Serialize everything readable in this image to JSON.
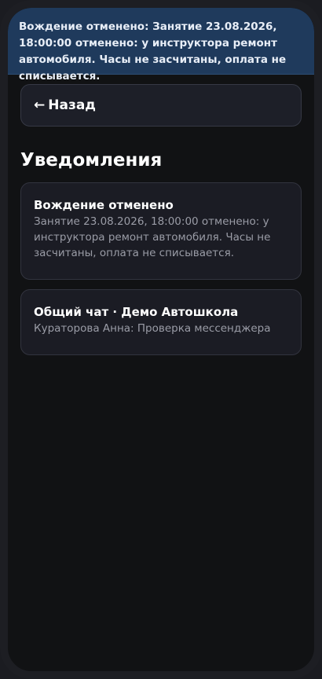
{
  "toast": {
    "text": "Вождение отменено: Занятие 23.08.2026, 18:00:00 отменено: у инструктора ремонт автомобиля. Часы не засчитаны, оплата не списывается."
  },
  "back_button": {
    "arrow": "←",
    "label": "Назад"
  },
  "page": {
    "title": "Уведомления"
  },
  "notifications": [
    {
      "title": "Вождение отменено",
      "text": "Занятие 23.08.2026, 18:00:00 отменено: у инструктора ремонт автомобиля. Часы не засчитаны, оплата не списывается."
    },
    {
      "title": "Общий чат · Демо Автошкола",
      "text": "Кураторова Анна: Проверка мессенджера"
    }
  ],
  "colors": {
    "background": "#111214",
    "toast": "#1f3a5c",
    "card": "#1b1c24",
    "muted_text": "#9a9ca6"
  }
}
